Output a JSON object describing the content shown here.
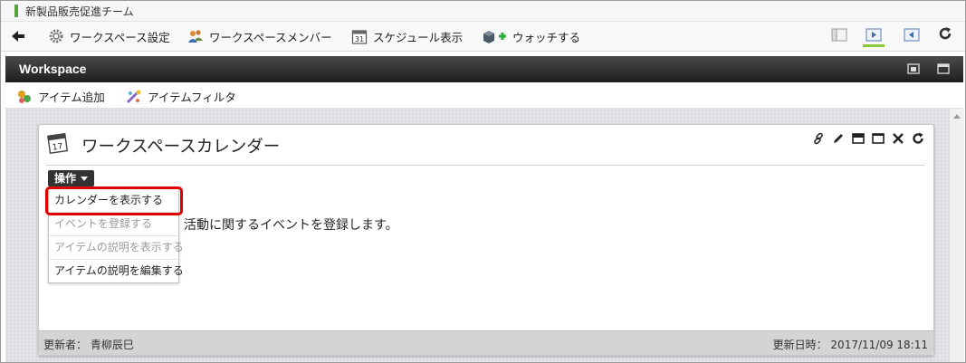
{
  "window": {
    "title": "新製品販売促進チーム"
  },
  "toolbar": {
    "items": [
      {
        "label": "ワークスペース設定",
        "icon": "gear-icon"
      },
      {
        "label": "ワークスペースメンバー",
        "icon": "users-icon"
      },
      {
        "label": "スケジュール表示",
        "icon": "calendar-icon"
      },
      {
        "label": "ウォッチする",
        "icon": "watch-add-icon"
      }
    ],
    "layout_buttons": [
      "layout-single-icon",
      "layout-right-icon",
      "layout-left-icon"
    ],
    "active_layout": "layout-right-icon"
  },
  "workspace": {
    "title": "Workspace",
    "actions": [
      {
        "label": "アイテム追加",
        "icon": "add-item-icon"
      },
      {
        "label": "アイテムフィルタ",
        "icon": "filter-icon"
      }
    ]
  },
  "portlet": {
    "title": "ワークスペースカレンダー",
    "operation_label": "操作",
    "description": "活動に関するイベントを登録します。",
    "menu": [
      {
        "label": "カレンダーを表示する",
        "enabled": true,
        "highlighted": true
      },
      {
        "label": "イベントを登録する",
        "enabled": false
      },
      {
        "label": "アイテムの説明を表示する",
        "enabled": false
      },
      {
        "label": "アイテムの説明を編集する",
        "enabled": true
      }
    ],
    "footer": {
      "updated_by": "更新者： 青柳辰巳",
      "updated_at": "更新日時： 2017/11/09 18:11"
    }
  },
  "colors": {
    "accent_green": "#8cc63f",
    "highlight_red": "#e00000",
    "header_dark": "#2a2a2a"
  }
}
